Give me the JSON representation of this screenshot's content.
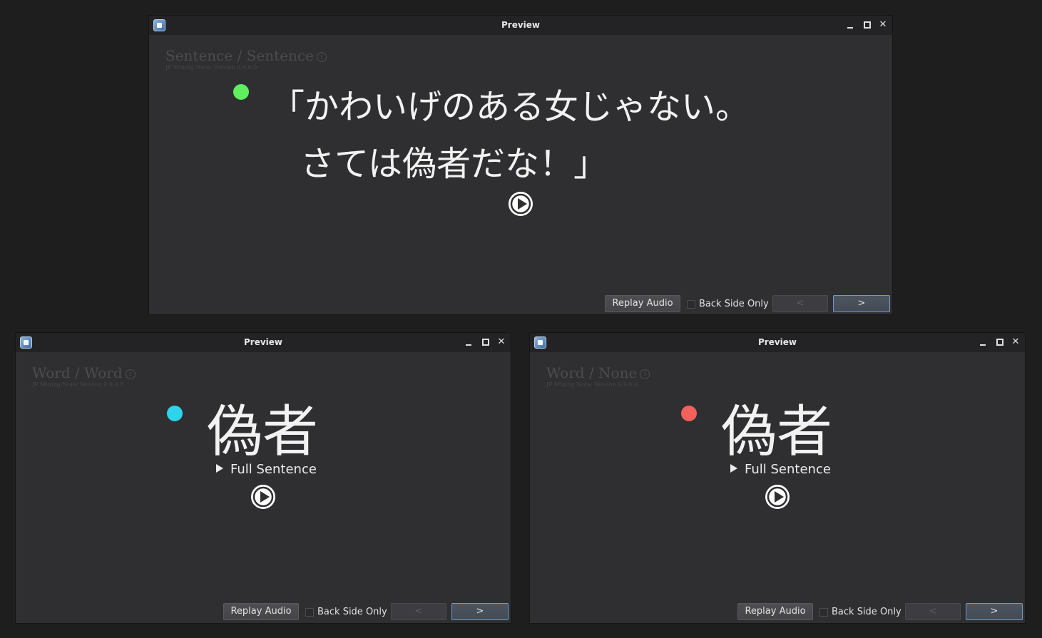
{
  "windows": [
    {
      "title": "Preview",
      "card_type": "Sentence / Sentence",
      "version": "JP Mining Note: Version 0.9.0.0",
      "dot_color": "#5ef05e",
      "display_lines": [
        "「かわいげのある女じゃない。",
        "さては偽者だな！」"
      ],
      "full_sentence": "",
      "replay_audio": "Replay Audio",
      "back_side_only": "Back Side Only",
      "prev": "<",
      "next": ">"
    },
    {
      "title": "Preview",
      "card_type": "Word / Word",
      "version": "JP Mining Note: Version 0.9.0.0",
      "dot_color": "#2ed3ec",
      "display_lines": [
        "偽者"
      ],
      "full_sentence": "Full Sentence",
      "replay_audio": "Replay Audio",
      "back_side_only": "Back Side Only",
      "prev": "<",
      "next": ">"
    },
    {
      "title": "Preview",
      "card_type": "Word / None",
      "version": "JP Mining Note: Version 0.9.0.0",
      "dot_color": "#f4615a",
      "display_lines": [
        "偽者"
      ],
      "full_sentence": "Full Sentence",
      "replay_audio": "Replay Audio",
      "back_side_only": "Back Side Only",
      "prev": "<",
      "next": ">"
    }
  ]
}
